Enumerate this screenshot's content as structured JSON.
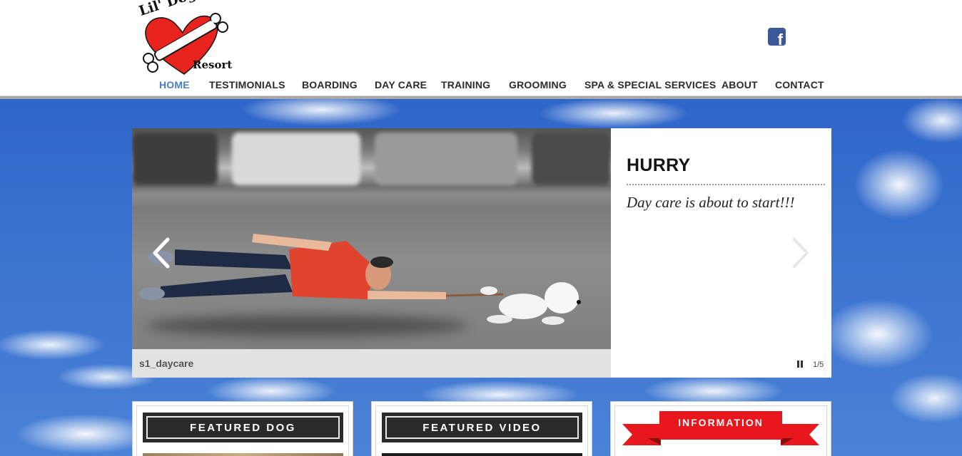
{
  "logo": {
    "line1": "Lil' Dogs",
    "line2": "Resort"
  },
  "social": {
    "facebook_glyph": "f",
    "icon": "facebook-icon",
    "color": "#3b5998"
  },
  "nav": {
    "items": [
      {
        "label": "HOME"
      },
      {
        "label": "TESTIMONIALS"
      },
      {
        "label": "BOARDING"
      },
      {
        "label": "DAY CARE"
      },
      {
        "label": "TRAINING"
      },
      {
        "label": "GROOMING"
      },
      {
        "label": "SPA & SPECIAL SERVICES"
      },
      {
        "label": "ABOUT"
      },
      {
        "label": "CONTACT"
      }
    ],
    "active_color": "#4a7fbf"
  },
  "slideshow": {
    "image_caption": "s1_daycare",
    "title": "HURRY",
    "text": "Day care is about to start!!!",
    "counter": "1/5",
    "prev_icon": "chevron-left-icon",
    "next_icon": "chevron-right-icon",
    "pause_icon": "pause-icon"
  },
  "sections": {
    "featured_dog": "FEATURED DOG",
    "featured_video": "FEATURED VIDEO",
    "information": "INFORMATION"
  },
  "colors": {
    "ribbon": "#e8171d",
    "sky": "#3a72d0"
  }
}
